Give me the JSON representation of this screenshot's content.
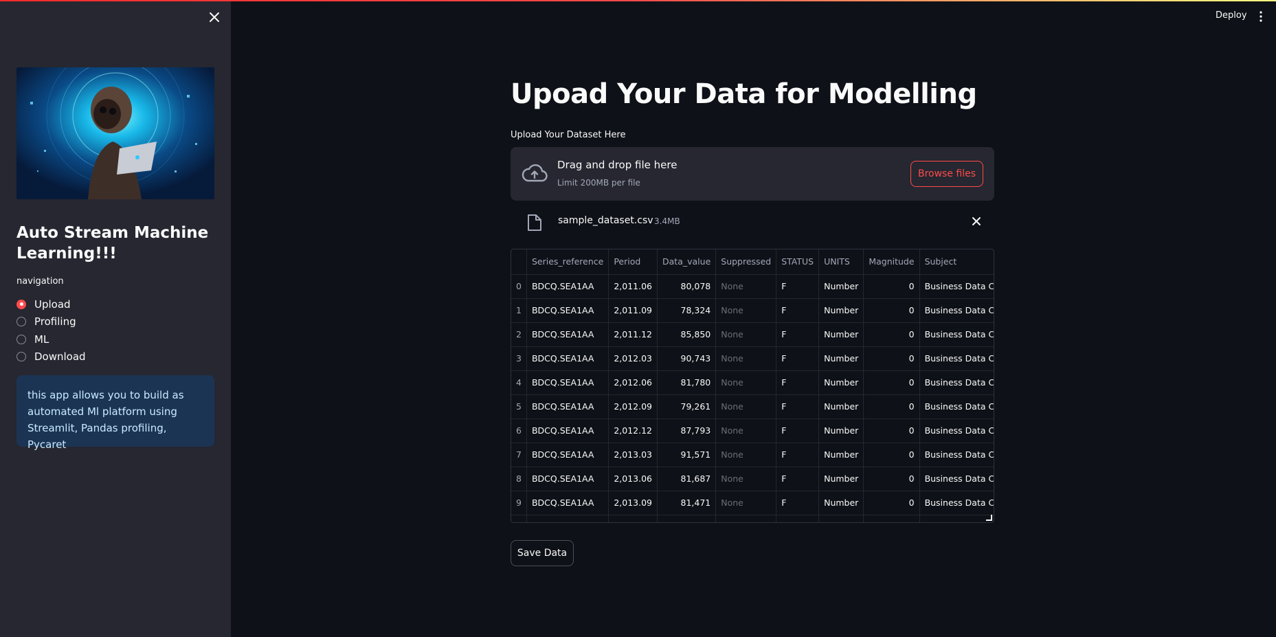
{
  "header": {
    "deploy_label": "Deploy"
  },
  "sidebar": {
    "title": "Auto Stream Machine Learning!!!",
    "nav_label": "navigation",
    "nav_options": [
      {
        "label": "Upload",
        "selected": true
      },
      {
        "label": "Profiling",
        "selected": false
      },
      {
        "label": "ML",
        "selected": false
      },
      {
        "label": "Download",
        "selected": false
      }
    ],
    "info_text": "this app allows you to build as automated Ml platform using Streamlit, Pandas profiling, Pycaret"
  },
  "main": {
    "title": "Upoad Your Data for Modelling",
    "uploader": {
      "label": "Upload Your Dataset Here",
      "drag_text": "Drag and drop file here",
      "limit_text": "Limit 200MB per file",
      "browse_label": "Browse files"
    },
    "file": {
      "name": "sample_dataset.csv",
      "size": "3.4MB"
    },
    "table": {
      "columns": [
        "",
        "Series_reference",
        "Period",
        "Data_value",
        "Suppressed",
        "STATUS",
        "UNITS",
        "Magnitude",
        "Subject"
      ],
      "rows": [
        [
          "0",
          "BDCQ.SEA1AA",
          "2,011.06",
          "80,078",
          "None",
          "F",
          "Number",
          "0",
          "Business Data Co"
        ],
        [
          "1",
          "BDCQ.SEA1AA",
          "2,011.09",
          "78,324",
          "None",
          "F",
          "Number",
          "0",
          "Business Data Co"
        ],
        [
          "2",
          "BDCQ.SEA1AA",
          "2,011.12",
          "85,850",
          "None",
          "F",
          "Number",
          "0",
          "Business Data Co"
        ],
        [
          "3",
          "BDCQ.SEA1AA",
          "2,012.03",
          "90,743",
          "None",
          "F",
          "Number",
          "0",
          "Business Data Co"
        ],
        [
          "4",
          "BDCQ.SEA1AA",
          "2,012.06",
          "81,780",
          "None",
          "F",
          "Number",
          "0",
          "Business Data Co"
        ],
        [
          "5",
          "BDCQ.SEA1AA",
          "2,012.09",
          "79,261",
          "None",
          "F",
          "Number",
          "0",
          "Business Data Co"
        ],
        [
          "6",
          "BDCQ.SEA1AA",
          "2,012.12",
          "87,793",
          "None",
          "F",
          "Number",
          "0",
          "Business Data Co"
        ],
        [
          "7",
          "BDCQ.SEA1AA",
          "2,013.03",
          "91,571",
          "None",
          "F",
          "Number",
          "0",
          "Business Data Co"
        ],
        [
          "8",
          "BDCQ.SEA1AA",
          "2,013.06",
          "81,687",
          "None",
          "F",
          "Number",
          "0",
          "Business Data Co"
        ],
        [
          "9",
          "BDCQ.SEA1AA",
          "2,013.09",
          "81,471",
          "None",
          "F",
          "Number",
          "0",
          "Business Data Co"
        ],
        [
          "",
          "",
          "",
          "",
          "",
          "",
          "",
          "",
          ""
        ]
      ]
    },
    "save_label": "Save Data"
  },
  "colors": {
    "accent": "#ff4b4b",
    "sidebar_bg": "#262730",
    "main_bg": "#0e1117",
    "info_bg": "#1c3454"
  },
  "icons": [
    "close-icon",
    "kebab-menu-icon",
    "cloud-upload-icon",
    "file-icon",
    "remove-icon",
    "resize-handle-icon"
  ]
}
